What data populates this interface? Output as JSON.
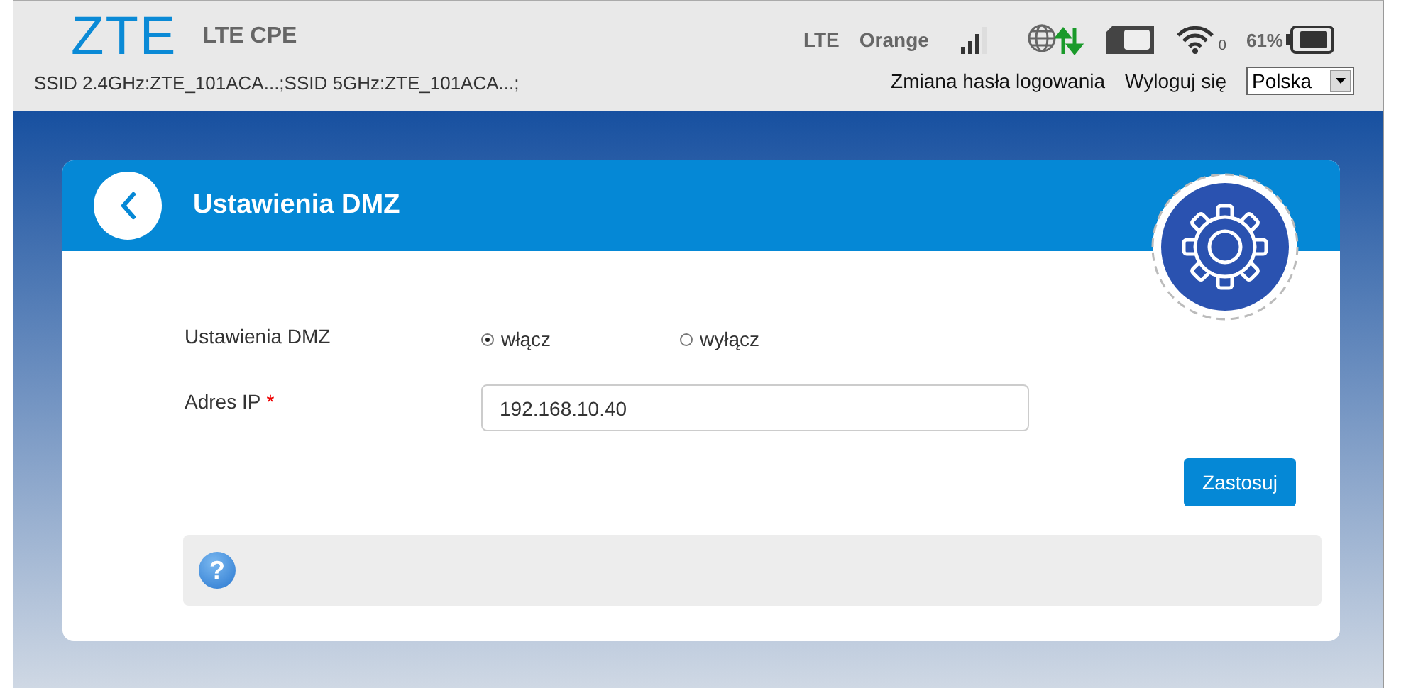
{
  "header": {
    "brand": "ZTE",
    "product": "LTE CPE",
    "ssid": "SSID 2.4GHz:ZTE_101ACA...;SSID 5GHz:ZTE_101ACA...;",
    "network_type": "LTE",
    "operator": "Orange",
    "wifi_clients": "0",
    "battery": "61%",
    "links": [
      {
        "label": "Zmiana hasła logowania"
      },
      {
        "label": "Wyloguj się"
      }
    ],
    "language": "Polska"
  },
  "panel": {
    "title": "Ustawienia DMZ",
    "dmz": {
      "label": "Ustawienia DMZ",
      "options": [
        {
          "label": "włącz",
          "selected": true
        },
        {
          "label": "wyłącz",
          "selected": false
        }
      ]
    },
    "ip": {
      "label": "Adres IP",
      "required_mark": "*",
      "value": "192.168.10.40"
    },
    "apply": "Zastosuj",
    "help": "?"
  }
}
